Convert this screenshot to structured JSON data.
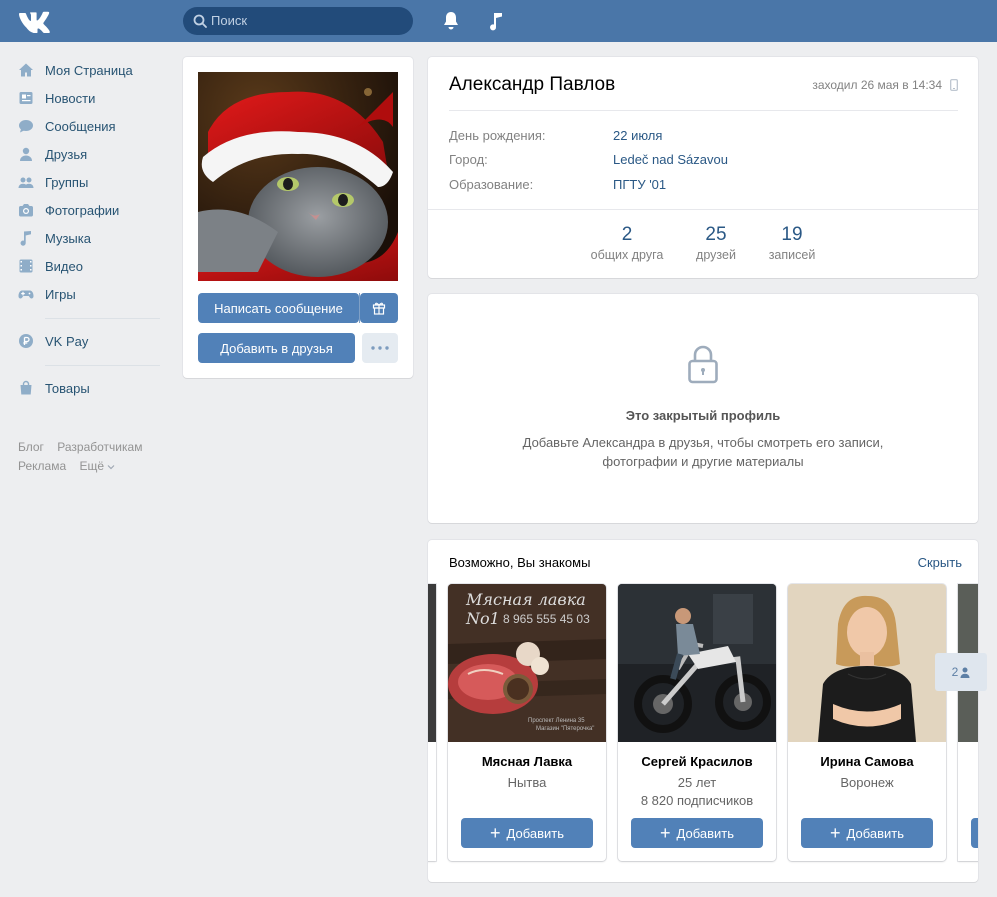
{
  "header": {
    "logo": "VK",
    "search_placeholder": "Поиск"
  },
  "sidebar": {
    "items": [
      {
        "label": "Моя Страница",
        "icon": "home-icon"
      },
      {
        "label": "Новости",
        "icon": "news-icon"
      },
      {
        "label": "Сообщения",
        "icon": "messages-icon"
      },
      {
        "label": "Друзья",
        "icon": "friend-icon"
      },
      {
        "label": "Группы",
        "icon": "groups-icon"
      },
      {
        "label": "Фотографии",
        "icon": "camera-icon"
      },
      {
        "label": "Музыка",
        "icon": "music-icon"
      },
      {
        "label": "Видео",
        "icon": "video-icon"
      },
      {
        "label": "Игры",
        "icon": "gamepad-icon"
      },
      {
        "label": "VK Pay",
        "icon": "ruble-icon"
      },
      {
        "label": "Товары",
        "icon": "bag-icon"
      }
    ],
    "footer": [
      "Блог",
      "Разработчикам",
      "Реклама",
      "Ещё"
    ]
  },
  "profile": {
    "name": "Александр Павлов",
    "last_seen": "заходил 26 мая в 14:34",
    "write_button": "Написать сообщение",
    "add_button": "Добавить в друзья",
    "fields": [
      {
        "label": "День рождения:",
        "value": "22 июля"
      },
      {
        "label": "Город:",
        "value": "Ledeč nad Sázavou"
      },
      {
        "label": "Образование:",
        "value": "ПГТУ '01"
      }
    ],
    "counters": [
      {
        "n": "2",
        "label": "общих друга"
      },
      {
        "n": "25",
        "label": "друзей"
      },
      {
        "n": "19",
        "label": "записей"
      }
    ]
  },
  "closed": {
    "title": "Это закрытый профиль",
    "text": "Добавьте Александра в друзья, чтобы смотреть его записи, фотографии и другие материалы"
  },
  "suggestions": {
    "title": "Возможно, Вы знакомы",
    "hide": "Скрыть",
    "add_label": "Добавить",
    "badge": "2",
    "people": [
      {
        "name": "Мясная Лавка",
        "sub1": "Нытва",
        "sub2": "",
        "photo_text": "Мясная лавка No1",
        "photo_phone": "8 965 555 45 03",
        "photo_small1": "Проспект Ленина 35",
        "photo_small2": "Магазин \"Пятерочка\""
      },
      {
        "name": "Сергей Красилов",
        "sub1": "25 лет",
        "sub2": "8 820 подписчиков"
      },
      {
        "name": "Ирина Самова",
        "sub1": "Воронеж",
        "sub2": ""
      }
    ]
  }
}
